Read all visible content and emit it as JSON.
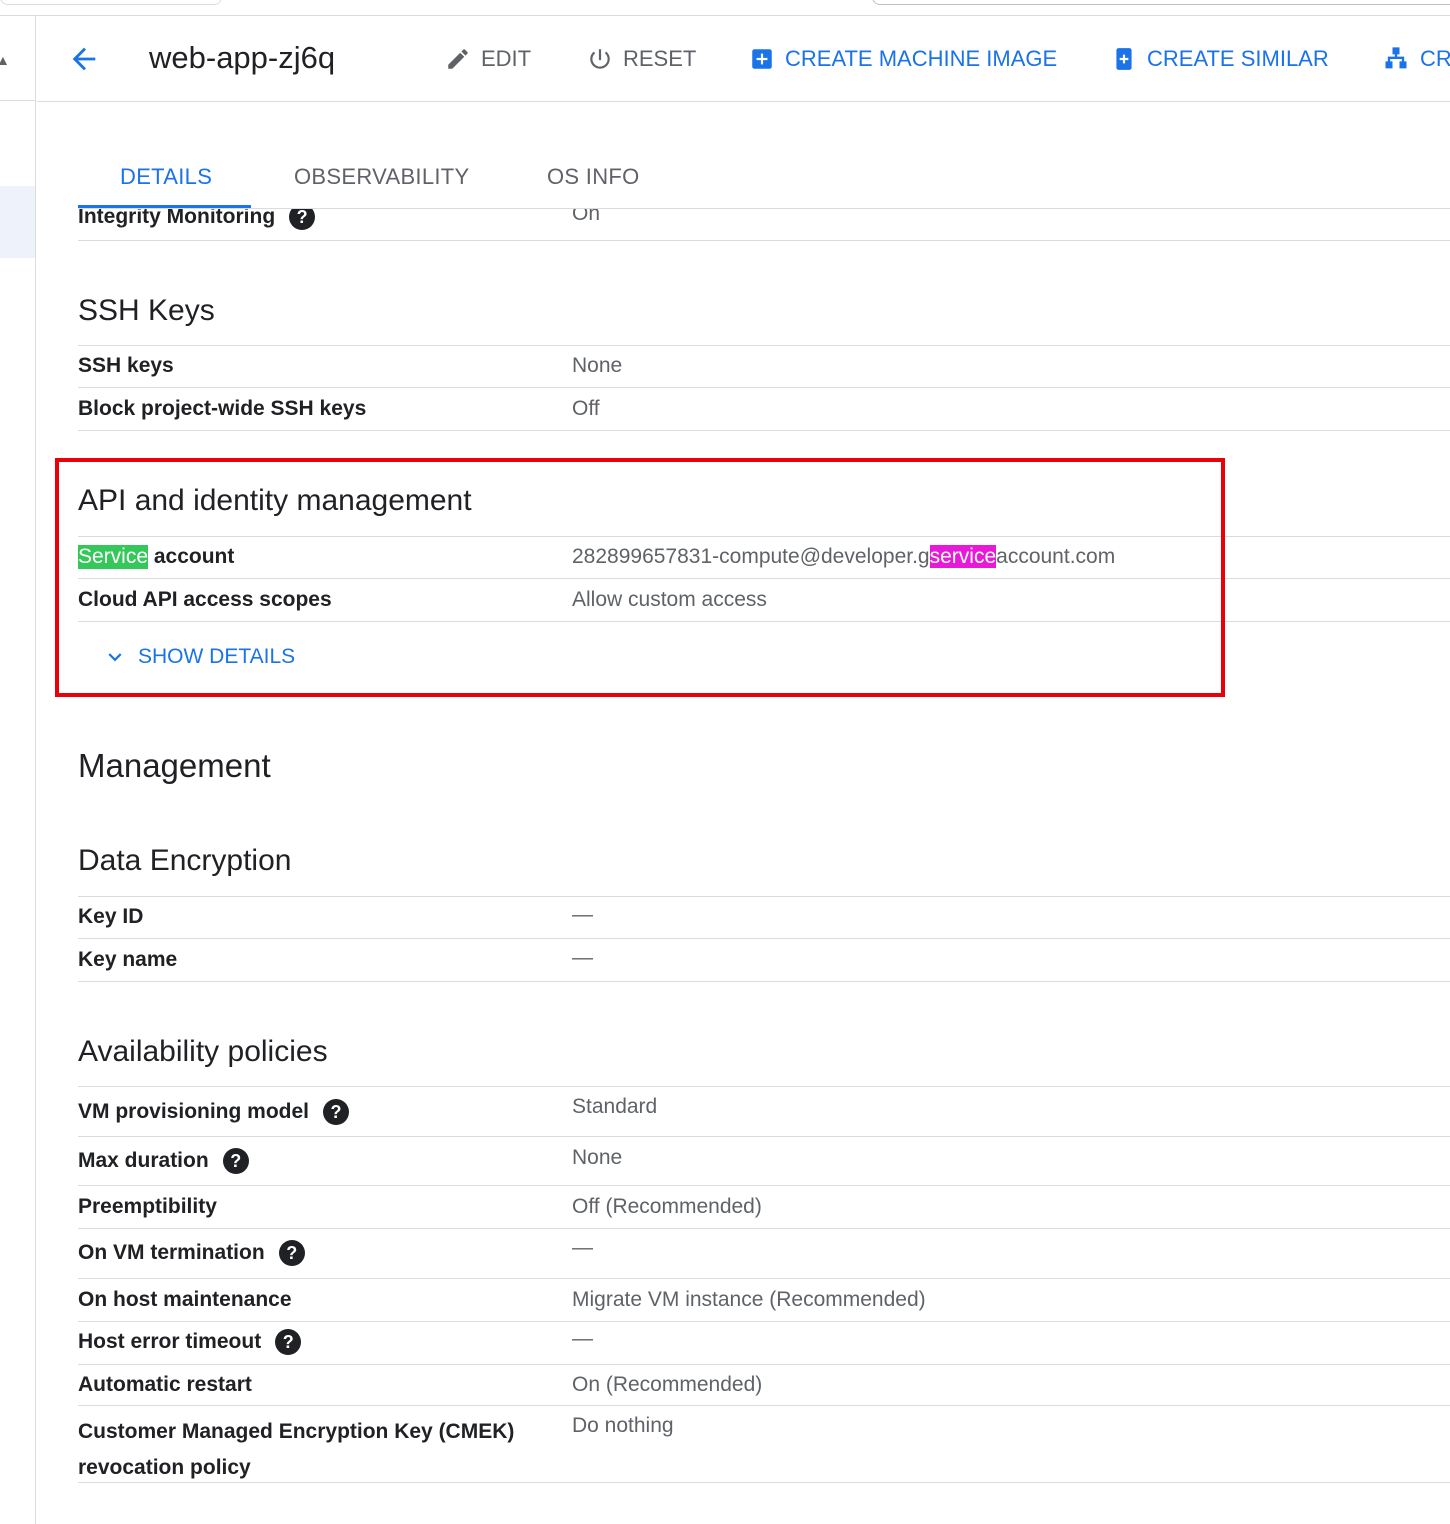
{
  "header": {
    "title": "web-app-zj6q",
    "edit_label": "EDIT",
    "reset_label": "RESET",
    "create_machine_image_label": "CREATE MACHINE IMAGE",
    "create_similar_label": "CREATE SIMILAR",
    "create_truncated_label": "CRI"
  },
  "tabs": [
    {
      "label": "DETAILS",
      "active": true
    },
    {
      "label": "OBSERVABILITY",
      "active": false
    },
    {
      "label": "OS INFO",
      "active": false
    }
  ],
  "shielded": {
    "integrity_label": "Integrity Monitoring",
    "integrity_value": "On"
  },
  "ssh": {
    "title": "SSH Keys",
    "rows": [
      {
        "label": "SSH keys",
        "value": "None"
      },
      {
        "label": "Block project-wide SSH keys",
        "value": "Off"
      }
    ]
  },
  "api": {
    "title": "API and identity management",
    "service_label_hl": "Service",
    "service_label_rest": " account",
    "service_value_pre": "282899657831-compute@developer.g",
    "service_value_hl": "service",
    "service_value_post": "account.com",
    "scopes_label": "Cloud API access scopes",
    "scopes_value": "Allow custom access",
    "show_details": "SHOW DETAILS"
  },
  "management": {
    "title": "Management"
  },
  "encryption": {
    "title": "Data Encryption",
    "rows": [
      {
        "label": "Key ID",
        "value": "—"
      },
      {
        "label": "Key name",
        "value": "—"
      }
    ]
  },
  "availability": {
    "title": "Availability policies",
    "rows": [
      {
        "label": "VM provisioning model",
        "value": "Standard"
      },
      {
        "label": "Max duration",
        "value": "None"
      },
      {
        "label": "Preemptibility",
        "value": "Off (Recommended)"
      },
      {
        "label": "On VM termination",
        "value": "—"
      },
      {
        "label": "On host maintenance",
        "value": "Migrate VM instance (Recommended)"
      },
      {
        "label": "Host error timeout",
        "value": "—"
      },
      {
        "label": "Automatic restart",
        "value": "On (Recommended)"
      },
      {
        "label_line1": "Customer Managed Encryption Key (CMEK)",
        "label_line2": "revocation policy",
        "value": "Do nothing"
      }
    ]
  },
  "icons": {
    "back": "arrow-back-icon",
    "edit": "pencil-icon",
    "reset": "power-icon",
    "create_machine_image": "add-box-icon",
    "create_similar": "add-doc-icon",
    "create_truncated": "hierarchy-icon",
    "show_details": "chevron-down-icon",
    "help": "help-circle-icon"
  },
  "colors": {
    "accent": "#1a73e8",
    "highlight_box": "#e8000b",
    "highlight_green": "#34c759",
    "highlight_magenta": "#e81ad9"
  }
}
